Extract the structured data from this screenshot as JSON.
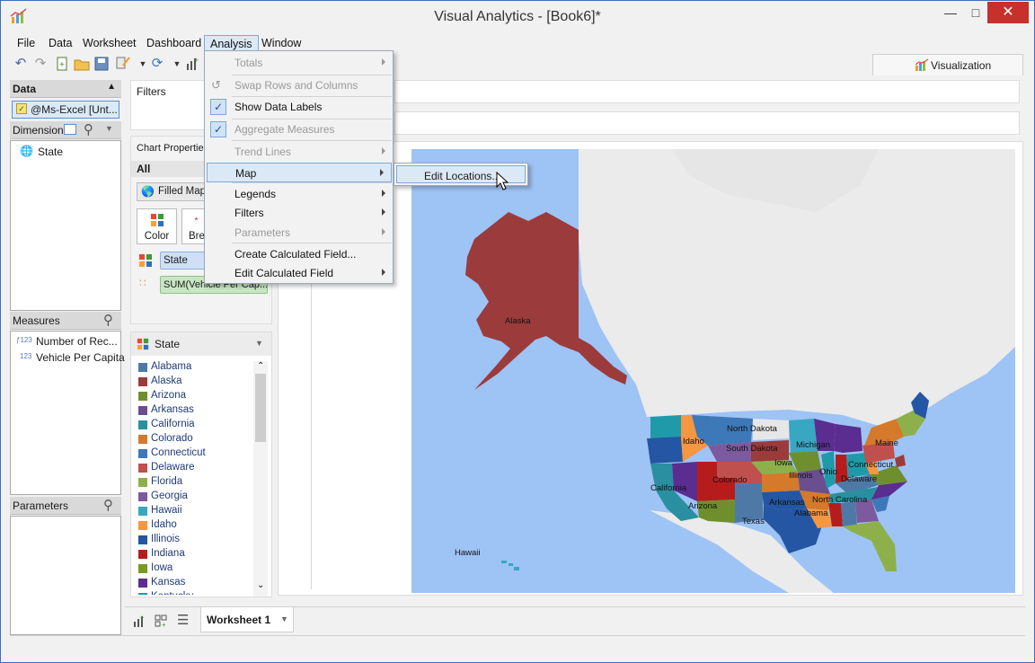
{
  "window": {
    "title": "Visual Analytics - [Book6]*"
  },
  "menubar": [
    "File",
    "Data",
    "Worksheet",
    "Dashboard",
    "Analysis",
    "Window"
  ],
  "visualization_tab": {
    "label": "Visualization"
  },
  "data_panel": {
    "title": "Data",
    "source": "@Ms-Excel [Unt...",
    "dimensions_label": "Dimensions",
    "dimensions": [
      "State"
    ],
    "measures_label": "Measures",
    "measures": [
      "Number of Rec...",
      "Vehicle Per Capita"
    ],
    "parameters_label": "Parameters"
  },
  "filters": {
    "label": "Filters"
  },
  "chart_properties": {
    "label": "Chart Properties",
    "all_label": "All",
    "chart_type": "Filled Map",
    "buttons": [
      "Color",
      "Bre"
    ],
    "color_pill": "State",
    "size_pill": "SUM(Vehicle Per Cap..."
  },
  "state_legend": {
    "title": "State",
    "items": [
      {
        "label": "Alabama",
        "color": "#4e79a7"
      },
      {
        "label": "Alaska",
        "color": "#9c3b3b"
      },
      {
        "label": "Arizona",
        "color": "#6f8f2e"
      },
      {
        "label": "Arkansas",
        "color": "#6a4e8f"
      },
      {
        "label": "California",
        "color": "#2a8fa0"
      },
      {
        "label": "Colorado",
        "color": "#d47a2a"
      },
      {
        "label": "Connecticut",
        "color": "#3d78b8"
      },
      {
        "label": "Delaware",
        "color": "#c0504d"
      },
      {
        "label": "Florida",
        "color": "#8db04a"
      },
      {
        "label": "Georgia",
        "color": "#7d5a9e"
      },
      {
        "label": "Hawaii",
        "color": "#38a7c2"
      },
      {
        "label": "Idaho",
        "color": "#f59640"
      },
      {
        "label": "Illinois",
        "color": "#2456a3"
      },
      {
        "label": "Indiana",
        "color": "#b71c1c"
      },
      {
        "label": "Iowa",
        "color": "#7a9a23"
      },
      {
        "label": "Kansas",
        "color": "#5b2d91"
      },
      {
        "label": "Kentucky",
        "color": "#1f9aa8"
      }
    ]
  },
  "analysis_menu": {
    "items": [
      {
        "label": "Totals",
        "disabled": true,
        "submenu": true,
        "checked": false
      },
      {
        "label": "Swap Rows and Columns",
        "disabled": true,
        "submenu": false,
        "checked": false
      },
      {
        "label": "Show Data Labels",
        "disabled": false,
        "submenu": false,
        "checked": true
      },
      {
        "label": "Aggregate Measures",
        "disabled": true,
        "submenu": false,
        "checked": true
      },
      {
        "label": "Trend Lines",
        "disabled": true,
        "submenu": true,
        "checked": false
      },
      {
        "label": "Map",
        "disabled": false,
        "submenu": true,
        "checked": false,
        "highlighted": true
      },
      {
        "label": "Legends",
        "disabled": false,
        "submenu": true,
        "checked": false
      },
      {
        "label": "Filters",
        "disabled": false,
        "submenu": true,
        "checked": false
      },
      {
        "label": "Parameters",
        "disabled": true,
        "submenu": true,
        "checked": false
      },
      {
        "label": "Create Calculated Field...",
        "disabled": false,
        "submenu": false,
        "checked": false
      },
      {
        "label": "Edit Calculated Field",
        "disabled": false,
        "submenu": true,
        "checked": false
      }
    ],
    "map_submenu": [
      "Edit Locations..."
    ]
  },
  "map": {
    "labels": [
      "Alaska",
      "Hawaii",
      "North Dakota",
      "South Dakota",
      "Idaho",
      "Michigan",
      "Maine",
      "Iowa",
      "Illinois",
      "Ohio",
      "Connecticut",
      "Delaware",
      "California",
      "Colorado",
      "Arizona",
      "Arkansas",
      "North Carolina",
      "Alabama",
      "Texas"
    ],
    "ocean_color": "#9ec3f5",
    "land_color": "#ebebeb"
  },
  "bottom_tabs": {
    "worksheet": "Worksheet 1"
  }
}
